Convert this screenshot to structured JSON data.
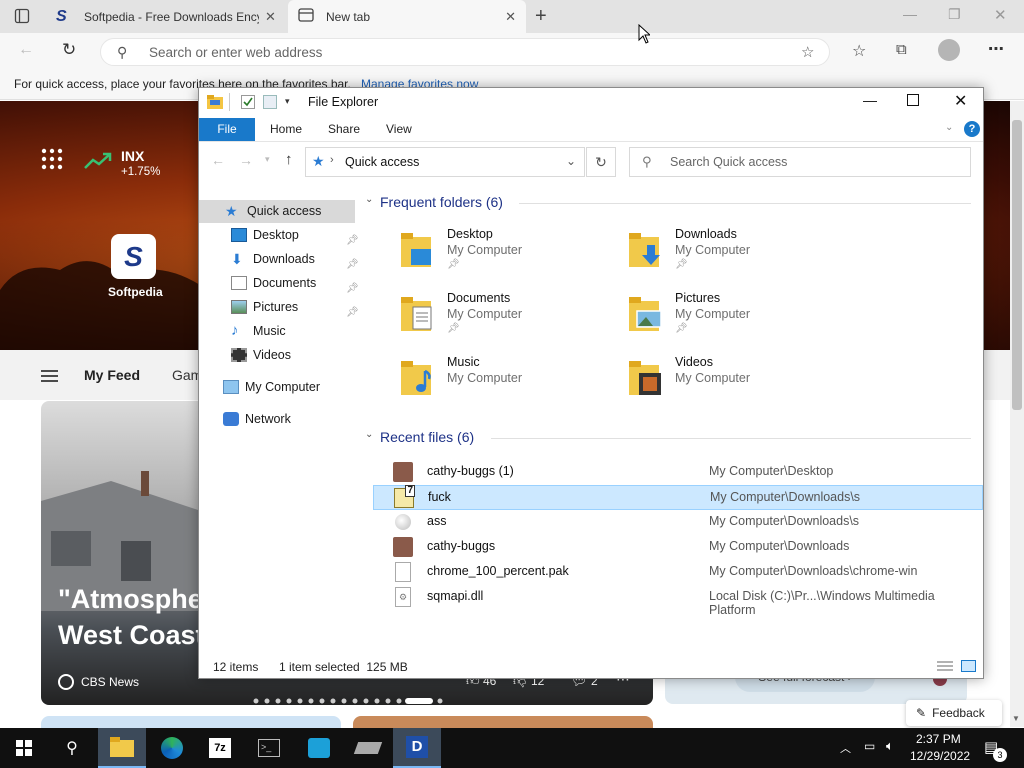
{
  "browser": {
    "tabs": [
      {
        "title": "Softpedia - Free Downloads Ency"
      },
      {
        "title": "New tab"
      }
    ],
    "address_placeholder": "Search or enter web address",
    "favbar_text": "For quick access, place your favorites here on the favorites bar.",
    "favbar_link": "Manage favorites now"
  },
  "newtab": {
    "stock_symbol": "INX",
    "stock_change": "+1.75%",
    "tile_label": "Softpedia",
    "feed_tab_active": "My Feed",
    "feed_tab_next": "Gam",
    "headline_line1": "\"Atmosphe",
    "headline_line2": "West Coast",
    "source": "CBS News",
    "likes": "46",
    "dislikes": "12",
    "comments": "2",
    "forecast": "See full forecast",
    "feedback": "Feedback"
  },
  "explorer": {
    "title": "File Explorer",
    "ribbon_tabs": [
      "File",
      "Home",
      "Share",
      "View"
    ],
    "address_location": "Quick access",
    "search_placeholder": "Search Quick access",
    "nav": {
      "quick_access": "Quick access",
      "items": [
        "Desktop",
        "Downloads",
        "Documents",
        "Pictures",
        "Music",
        "Videos"
      ],
      "my_computer": "My Computer",
      "network": "Network"
    },
    "frequent_header": "Frequent folders (6)",
    "folders": [
      {
        "name": "Desktop",
        "location": "My Computer"
      },
      {
        "name": "Downloads",
        "location": "My Computer"
      },
      {
        "name": "Documents",
        "location": "My Computer"
      },
      {
        "name": "Pictures",
        "location": "My Computer"
      },
      {
        "name": "Music",
        "location": "My Computer"
      },
      {
        "name": "Videos",
        "location": "My Computer"
      }
    ],
    "recent_header": "Recent files (6)",
    "files": [
      {
        "name": "cathy-buggs (1)",
        "path": "My Computer\\Desktop"
      },
      {
        "name": "fuck",
        "path": "My Computer\\Downloads\\s"
      },
      {
        "name": "ass",
        "path": "My Computer\\Downloads\\s"
      },
      {
        "name": "cathy-buggs",
        "path": "My Computer\\Downloads"
      },
      {
        "name": "chrome_100_percent.pak",
        "path": "My Computer\\Downloads\\chrome-win"
      },
      {
        "name": "sqmapi.dll",
        "path": "Local Disk (C:)\\Pr...\\Windows Multimedia Platform"
      }
    ],
    "status_items": "12 items",
    "status_selected": "1 item selected  125 MB"
  },
  "taskbar": {
    "time": "2:37 PM",
    "date": "12/29/2022",
    "notifications": "3"
  }
}
